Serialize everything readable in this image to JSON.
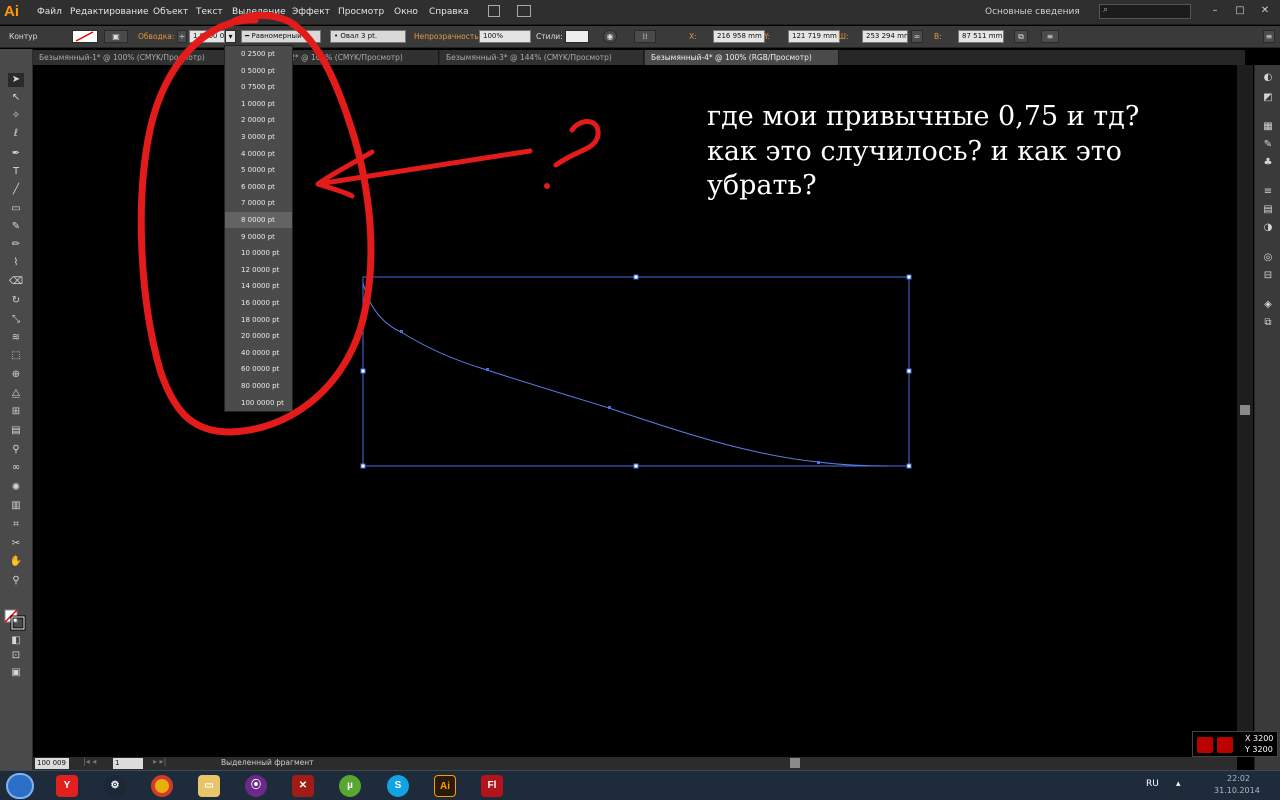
{
  "app": {
    "logo": "Ai"
  },
  "menu": [
    "Файл",
    "Редактирование",
    "Объект",
    "Текст",
    "Выделение",
    "Эффект",
    "Просмотр",
    "Окно",
    "Справка"
  ],
  "workspace": "Основные сведения",
  "control": {
    "object_type": "Контур",
    "stroke_label": "Обводка:",
    "stroke_value": "1.0000 000",
    "profile": "Равномерный",
    "brush": "Овал 3 pt.",
    "opacity_label": "Непрозрачность:",
    "opacity_value": "100%",
    "styles_label": "Стили:",
    "x_label": "X:",
    "x_value": "216 958 mm",
    "y_label": "Y:",
    "y_value": "121 719 mm",
    "w_label": "Ш:",
    "w_value": "253 294 mm",
    "h_label": "В:",
    "h_value": "87 511 mm"
  },
  "tabs": [
    {
      "label": "Безымянный-1* @ 100% (CMYK/Просмотр)",
      "active": false
    },
    {
      "label": "Безымянный-2* @ 100% (CMYK/Просмотр)",
      "active": false
    },
    {
      "label": "Безымянный-3* @ 144% (CMYK/Просмотр)",
      "active": false
    },
    {
      "label": "Безымянный-4* @ 100% (RGB/Просмотр)",
      "active": true
    }
  ],
  "stroke_dropdown": [
    "0 2500 pt",
    "0 5000 pt",
    "0 7500 pt",
    "1 0000 pt",
    "2 0000 pt",
    "3 0000 pt",
    "4 0000 pt",
    "5 0000 pt",
    "6 0000 pt",
    "7 0000 pt",
    "8 0000 pt",
    "9 0000 pt",
    "10 0000 pt",
    "12 0000 pt",
    "14 0000 pt",
    "16 0000 pt",
    "18 0000 pt",
    "20 0000 pt",
    "40 0000 pt",
    "60 0000 pt",
    "80 0000 pt",
    "100 0000 pt"
  ],
  "highlighted_item": "8 0000 pt",
  "annotation": {
    "text": "где мои привычные 0,75 и тд? как это случилось? и как это убрать?",
    "question_mark": "?"
  },
  "status": {
    "zoom": "100 009",
    "page": "1",
    "text": "Выделенный фрагмент"
  },
  "cursor_coords": {
    "x": "X 3200",
    "y": "Y 3200"
  },
  "taskbar": {
    "apps": [
      "Y",
      "Steam",
      "Chrome",
      "Explorer",
      "Media",
      "Dota 2",
      "uTorrent",
      "Skype",
      "Ai",
      "Fl"
    ],
    "lang": "RU",
    "time": "22:02",
    "date": "31.10.2014"
  },
  "colors": {
    "accent": "#ff9a00",
    "selection": "#4a6ee0",
    "marker": "#e31b1b"
  }
}
